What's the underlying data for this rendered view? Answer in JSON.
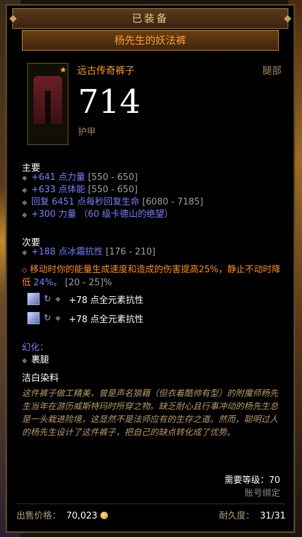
{
  "header": {
    "status": "已装备",
    "item_name": "杨先生的妖法裤"
  },
  "item": {
    "type": "远古传奇裤子",
    "slot": "腿部",
    "armor_value": "714",
    "armor_label": "护甲"
  },
  "primary": {
    "heading": "主要",
    "stats": [
      {
        "text": "+641 点力量",
        "range": "[550 - 650]"
      },
      {
        "text": "+633 点体能",
        "range": "[550 - 650]"
      },
      {
        "text": "回复 6451 点每秒回复生命",
        "range": "[6080 - 7185]"
      },
      {
        "text": "+300 力量 （60 级卡德山的绝望）",
        "range": ""
      }
    ]
  },
  "secondary": {
    "heading": "次要",
    "stats": [
      {
        "text": "+188 点冰霜抗性",
        "range": "[176 - 210]"
      }
    ],
    "legendary_part1": "移动时你的能量生成速度和造成的伤害提高25%，静止不动时降低 ",
    "legendary_value": "24%",
    "legendary_part2": "。 [20 - 25]%"
  },
  "sockets": [
    {
      "text": "+78 点全元素抗性"
    },
    {
      "text": "+78 点全元素抗性"
    }
  ],
  "transmog": {
    "heading": "幻化：",
    "value": "裹腿"
  },
  "dye": "洁白染料",
  "flavor": "这件裤子做工精美，曾是声名狼藉（但衣着酷帅有型）的附魔师杨先生当年在游历威斯特玛时所穿之物。缺乏耐心且行事冲动的杨先生总是一头栽进险境，这显然不是法师应有的生存之道。然而，聪明过人的杨先生设计了这件裤子，把自己的缺点转化成了优势。",
  "requirements": {
    "level": "需要等级：70",
    "bound": "账号绑定"
  },
  "footer": {
    "sell_label": "出售价格：",
    "sell_value": "70,023",
    "durability_label": "耐久度：",
    "durability_value": "31/31"
  }
}
